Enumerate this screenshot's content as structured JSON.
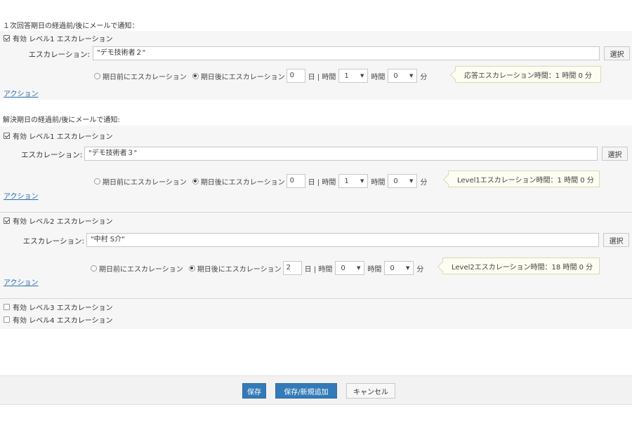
{
  "response_section": {
    "title": "１次回答期日の経過前/後にメールで通知：",
    "level1": {
      "checkbox_label": "有効 レベル1 エスカレーション",
      "escalation_label": "エスカレーション:",
      "escalation_value": "\"デモ技術者２\"",
      "select_button": "選択",
      "radio_before": "期日前にエスカレーション",
      "radio_after": "期日後にエスカレーション",
      "days_value": "0",
      "days_label": "日 | 時間",
      "hours_value": "1",
      "hours_label": "時間",
      "minutes_value": "0",
      "minutes_label": "分",
      "tip": "応答エスカレーション時間：1 時間 0 分",
      "action_link": "アクション"
    }
  },
  "resolve_section": {
    "title": "解決期日の経過前/後にメールで通知:",
    "level1": {
      "checkbox_label": "有効 レベル1 エスカレーション",
      "escalation_label": "エスカレーション:",
      "escalation_value": "\"デモ技術者３\"",
      "select_button": "選択",
      "radio_before": "期日前にエスカレーション",
      "radio_after": "期日後にエスカレーション",
      "days_value": "0",
      "days_label": "日 | 時間",
      "hours_value": "1",
      "hours_label": "時間",
      "minutes_value": "0",
      "minutes_label": "分",
      "tip": "Level1エスカレーション時間：1 時間 0 分",
      "action_link": "アクション"
    },
    "level2": {
      "checkbox_label": "有効 レベル2 エスカレーション",
      "escalation_label": "エスカレーション:",
      "escalation_value": "\"中村 S介\"",
      "select_button": "選択",
      "radio_before": "期日前にエスカレーション",
      "radio_after": "期日後にエスカレーション",
      "days_value": "2",
      "days_label": "日 | 時間",
      "hours_value": "0",
      "hours_label": "時間",
      "minutes_value": "0",
      "minutes_label": "分",
      "tip": "Level2エスカレーション時間：18 時間 0 分",
      "action_link": "アクション"
    },
    "level3": {
      "checkbox_label": "有効 レベル3 エスカレーション"
    },
    "level4": {
      "checkbox_label": "有効 レベル4 エスカレーション"
    }
  },
  "footer": {
    "save": "保存",
    "save_new": "保存/新規追加",
    "cancel": "キャンセル"
  },
  "colors": {
    "primary": "#337ab7",
    "link": "#2a6db5",
    "panel": "#f6f6f6",
    "tip_bg": "#fdfdf1"
  }
}
